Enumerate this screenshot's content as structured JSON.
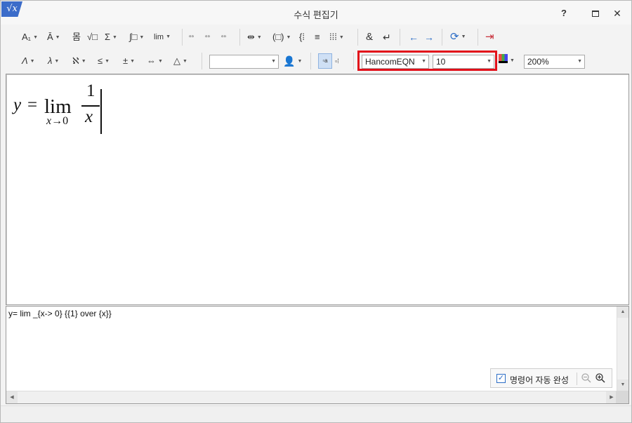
{
  "window": {
    "title": "수식 편집기",
    "app_icon": "√x"
  },
  "titlebar_buttons": {
    "help": "?",
    "close": "✕"
  },
  "toolbar1": {
    "items": [
      {
        "name": "font-style-icon",
        "label": "A₁"
      },
      {
        "name": "accent-icon",
        "label": "Ā"
      },
      {
        "name": "fraction-icon",
        "label": "몸"
      },
      {
        "name": "root-icon",
        "label": "√□"
      },
      {
        "name": "sum-icon",
        "label": "Σ"
      },
      {
        "name": "integral-icon",
        "label": "∫□"
      },
      {
        "name": "lim-icon",
        "label": "lim"
      },
      {
        "name": "matrix-small-icon",
        "label": "▫▫"
      },
      {
        "name": "tensor-icon",
        "label": "▫▫"
      },
      {
        "name": "binomial-icon",
        "label": "▫▫"
      },
      {
        "name": "bracket-wide-icon",
        "label": "⇹"
      },
      {
        "name": "paren-icon",
        "label": "(□)"
      },
      {
        "name": "cases-icon",
        "label": "{⁞"
      },
      {
        "name": "align-icon",
        "label": "≡"
      },
      {
        "name": "matrix-icon",
        "label": "⁞⁞⁞"
      },
      {
        "name": "ampersand-icon",
        "label": "&"
      },
      {
        "name": "newline-icon",
        "label": "↵"
      },
      {
        "name": "undo-icon",
        "label": "←"
      },
      {
        "name": "redo-icon",
        "label": "→"
      },
      {
        "name": "refresh-icon",
        "label": "⟳"
      },
      {
        "name": "exit-icon",
        "label": "⇥"
      }
    ]
  },
  "toolbar2": {
    "items": [
      {
        "name": "greek-upper-icon",
        "label": "Λ"
      },
      {
        "name": "greek-lower-icon",
        "label": "λ"
      },
      {
        "name": "hebrew-icon",
        "label": "ℵ"
      },
      {
        "name": "relation-icon",
        "label": "≤"
      },
      {
        "name": "operator-icon",
        "label": "±"
      },
      {
        "name": "arrow-icon",
        "label": "⇔"
      },
      {
        "name": "misc-symbol-icon",
        "label": "△"
      }
    ],
    "font_name": "HancomEQN",
    "font_size": "10",
    "zoom": "200%"
  },
  "editor": {
    "equation": {
      "lhs": "y",
      "equals": "=",
      "lim": "lim",
      "sub_var": "x",
      "sub_arrow": "→",
      "sub_val": "0",
      "numerator": "1",
      "denominator": "x"
    }
  },
  "script": {
    "text": "y= lim _{x-> 0} {{1} over {x}}"
  },
  "autocomplete": {
    "label": "명령어 자동 완성",
    "checked": true
  }
}
